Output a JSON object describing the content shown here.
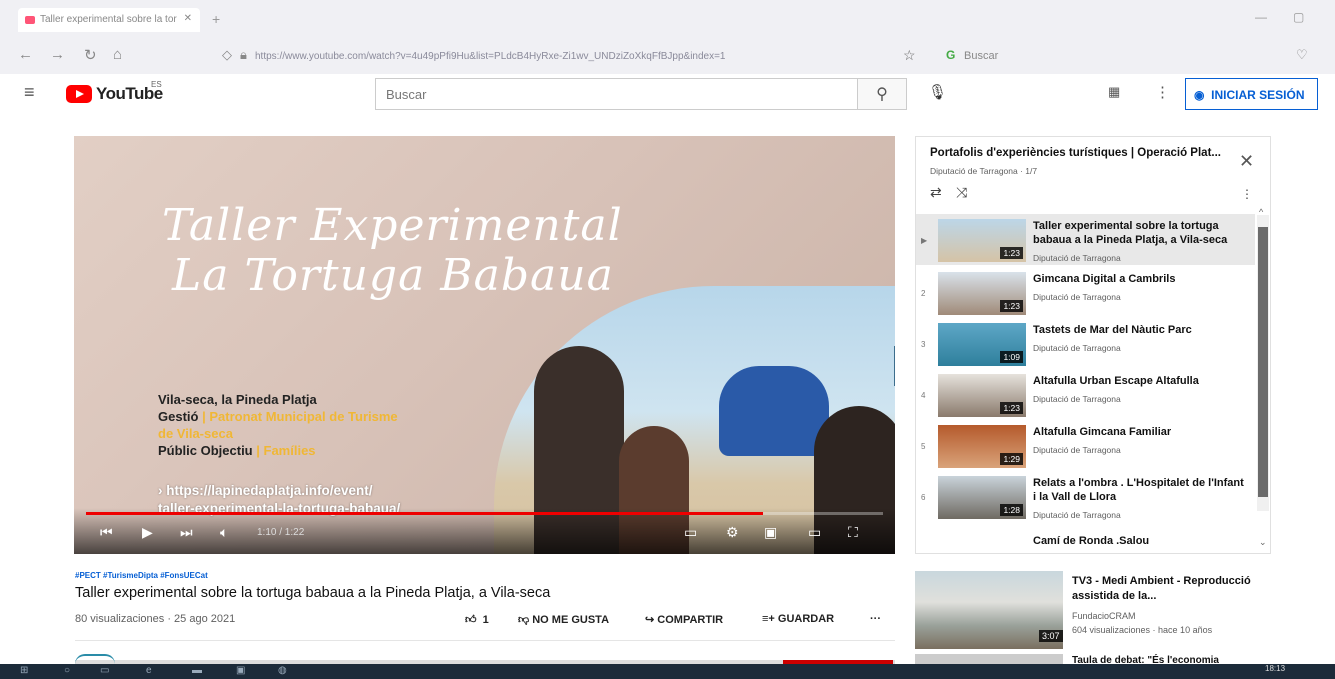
{
  "browser": {
    "tab_title": "Taller experimental sobre la tor",
    "url": "https://www.youtube.com/watch?v=4u49pPfi9Hu&list=PLdcB4HyRxe-Zi1wv_UNDziZoXkqFfBJpp&index=1",
    "search_placeholder": "Buscar"
  },
  "youtube": {
    "logo_text": "YouTube",
    "country_code": "ES",
    "search_placeholder": "Buscar",
    "signin_label": "INICIAR SESIÓN"
  },
  "player": {
    "overlay_title_line1": "Taller Experimental",
    "overlay_title_line2": "La Tortuga Babaua",
    "location": "Vila-seca, la Pineda Platja",
    "gestio_label": "Gestió",
    "gestio_value_line1": "Patronat Municipal de Turisme",
    "gestio_value_line2": "de Vila-seca",
    "public_label": "Públic Objectiu",
    "public_value": "Famílies",
    "link_line1": "› https://lapinedaplatja.info/event/",
    "link_line2": "taller-experimental-la-tortuga-babaua/",
    "time": "1:10 / 1:22",
    "progress": 0.85
  },
  "video": {
    "hashtags": "#PECT #TurismeDipta #FonsUECat",
    "title": "Taller experimental sobre la tortuga babaua a la Pineda Platja, a Vila-seca",
    "views_date": "80 visualizaciones · 25 ago 2021",
    "likes": "1",
    "dislike_label": "NO ME GUSTA",
    "share_label": "COMPARTIR",
    "save_label": "GUARDAR",
    "more": "···"
  },
  "playlist": {
    "title": "Portafolis d'experiències turístiques | Operació Plat...",
    "subtitle": "Diputació de Tarragona · 1/7",
    "items": [
      {
        "index": "▶",
        "title": "Taller experimental sobre la tortuga babaua a la Pineda Platja, a Vila-seca",
        "channel": "Diputació de Tarragona",
        "duration": "1:23"
      },
      {
        "index": "2",
        "title": "Gimcana Digital a Cambrils",
        "channel": "Diputació de Tarragona",
        "duration": "1:23"
      },
      {
        "index": "3",
        "title": "Tastets de Mar del Nàutic Parc",
        "channel": "Diputació de Tarragona",
        "duration": "1:09"
      },
      {
        "index": "4",
        "title": "Altafulla Urban Escape Altafulla",
        "channel": "Diputació de Tarragona",
        "duration": "1:23"
      },
      {
        "index": "5",
        "title": "Altafulla Gimcana Familiar",
        "channel": "Diputació de Tarragona",
        "duration": "1:29"
      },
      {
        "index": "6",
        "title": "Relats a l'ombra . L'Hospitalet de l'Infant i la Vall de Llora",
        "channel": "Diputació de Tarragona",
        "duration": "1:28"
      }
    ],
    "last_item": "Camí de Ronda .Salou"
  },
  "recommended": {
    "title": "TV3 - Medi Ambient - Reproducció assistida de la...",
    "channel": "FundacioCRAM",
    "meta": "604 visualizaciones · hace 10 años",
    "duration": "3:07",
    "next_title": "Taula de debat: \"És l'economia"
  },
  "taskbar": {
    "clock": "18:13"
  }
}
